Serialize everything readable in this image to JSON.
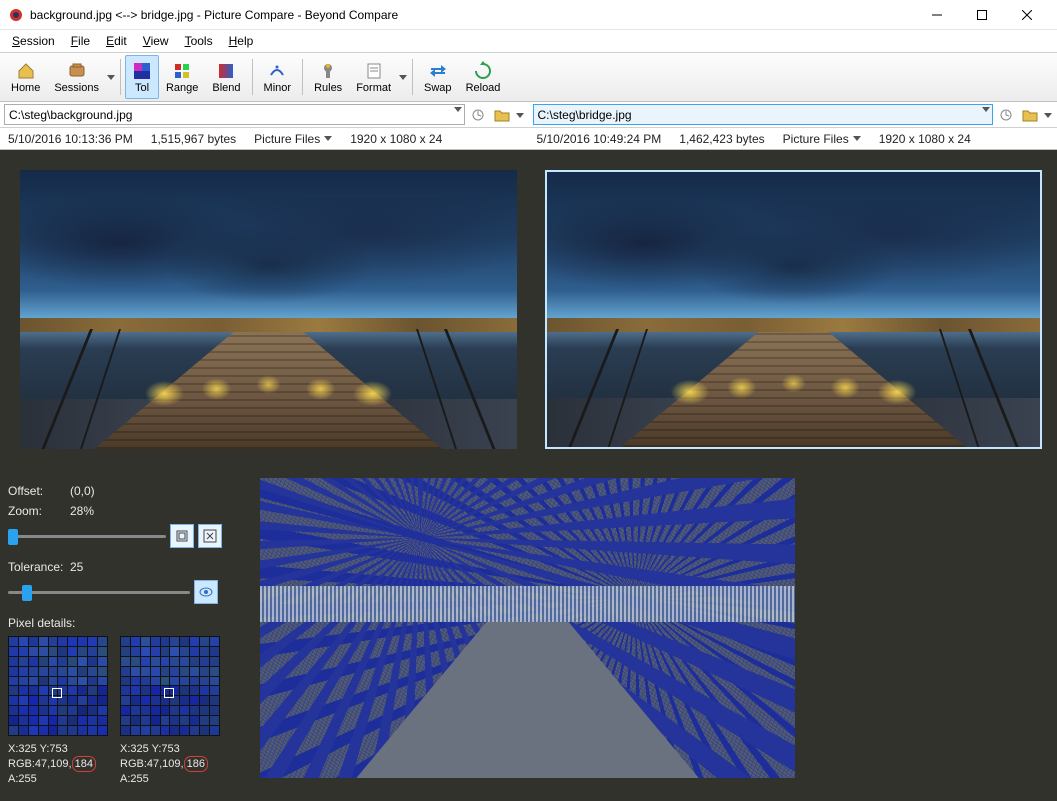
{
  "title": "background.jpg <--> bridge.jpg - Picture Compare - Beyond Compare",
  "menu": {
    "session": "Session",
    "file": "File",
    "edit": "Edit",
    "view": "View",
    "tools": "Tools",
    "help": "Help"
  },
  "toolbar": {
    "home": "Home",
    "sessions": "Sessions",
    "tol": "Tol",
    "range": "Range",
    "blend": "Blend",
    "minor": "Minor",
    "rules": "Rules",
    "format": "Format",
    "swap": "Swap",
    "reload": "Reload"
  },
  "left": {
    "path": "C:\\steg\\background.jpg",
    "timestamp": "5/10/2016 10:13:36 PM",
    "bytes": "1,515,967 bytes",
    "filetype": "Picture Files",
    "dims": "1920 x 1080 x 24"
  },
  "right": {
    "path": "C:\\steg\\bridge.jpg",
    "timestamp": "5/10/2016 10:49:24 PM",
    "bytes": "1,462,423 bytes",
    "filetype": "Picture Files",
    "dims": "1920 x 1080 x 24"
  },
  "panel": {
    "offset_label": "Offset:",
    "offset_value": "(0,0)",
    "zoom_label": "Zoom:",
    "zoom_value": "28%",
    "tolerance_label": "Tolerance:",
    "tolerance_value": "25",
    "pixel_details_label": "Pixel details:"
  },
  "pixel_left": {
    "xy": "X:325 Y:753",
    "rgb_prefix": "RGB:47,109,",
    "rgb_diff": "184",
    "a": "A:255"
  },
  "pixel_right": {
    "xy": "X:325 Y:753",
    "rgb_prefix": "RGB:47,109,",
    "rgb_diff": "186",
    "a": "A:255"
  }
}
